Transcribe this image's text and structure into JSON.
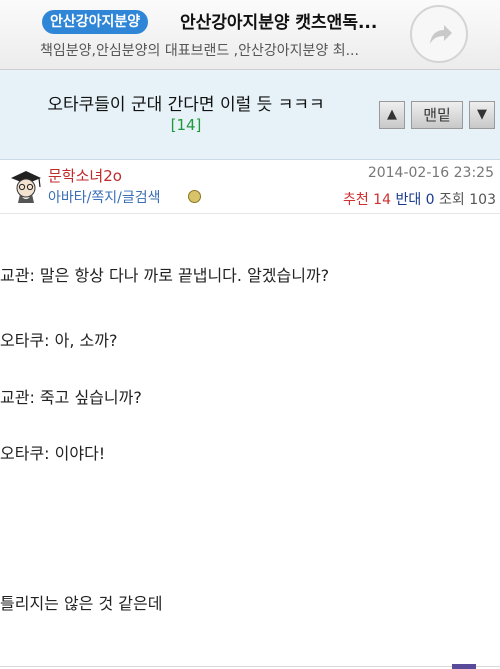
{
  "ad": {
    "badge": "안산강아지분양",
    "title": "안산강아지분양 캣츠앤독...",
    "subtitle": "책임분양,안심분양의 대표브랜드 ,안산강아지분양 최...",
    "button_icon": "share-arrow-icon"
  },
  "post": {
    "title": "오타쿠들이 군대 간다면 이럴 듯 ㅋㅋㅋ",
    "comment_count": "[14]"
  },
  "nav": {
    "up": "▲",
    "bottom": "맨밑",
    "down": "▼"
  },
  "author": {
    "nickname": "문학소녀2o",
    "links": "아바타/쪽지/글검색",
    "date": "2014-02-16 23:25",
    "recommend_label": "추천",
    "recommend_count": "14",
    "oppose_label": "반대",
    "oppose_count": "0",
    "views_label": "조회",
    "views_count": "103"
  },
  "body": {
    "lines": [
      "교관: 말은 항상 다나 까로 끝냅니다. 알겠습니까?",
      "오타쿠: 아, 소까?",
      "교관: 죽고 싶습니까?",
      "오타쿠: 이야다!",
      "틀리지는 않은 것 같은데"
    ]
  },
  "colors": {
    "badge": "#2f86d6",
    "title_bg": "#e6f2f8",
    "comment_count": "#1f9a3a",
    "nickname": "#c02a2a",
    "links": "#3a6fb8",
    "recommend": "#d03030",
    "oppose": "#1a3a90"
  }
}
